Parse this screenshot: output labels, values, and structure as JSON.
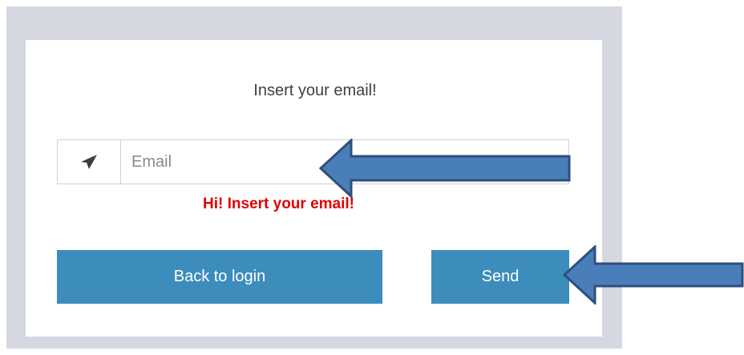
{
  "form": {
    "title": "Insert your email!",
    "email_placeholder": "Email",
    "email_value": "",
    "error_message": "Hi! Insert your email!",
    "back_label": "Back to login",
    "send_label": "Send",
    "input_icon": "paper-plane-icon"
  },
  "annotations": {
    "arrow_color": "#4a7ebb",
    "arrow_outline": "#2f4f7a",
    "arrows": [
      "arrow-pointing-to-email-input",
      "arrow-pointing-to-send-button"
    ]
  },
  "colors": {
    "button": "#3c8dbc",
    "error": "#e00000",
    "frame": "#d5d8e0"
  }
}
